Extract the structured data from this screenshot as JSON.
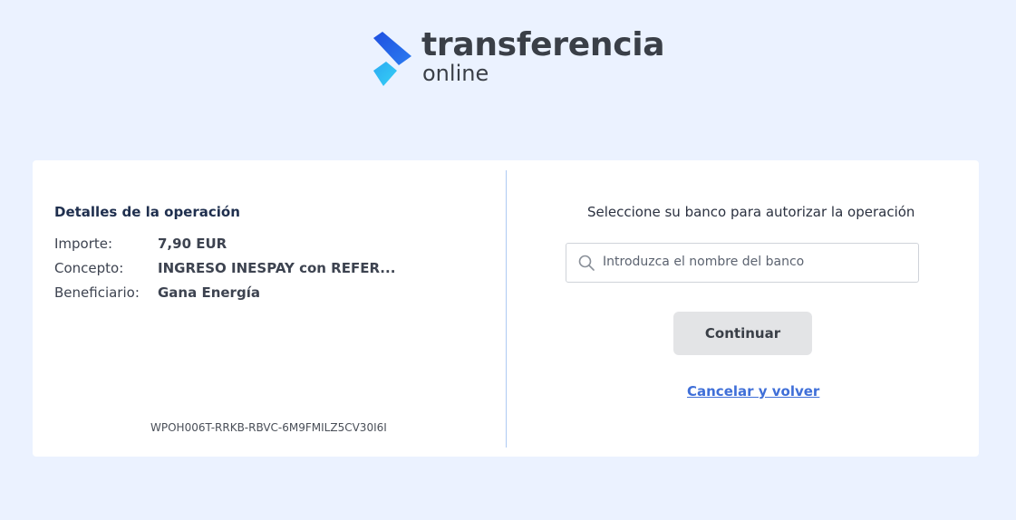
{
  "brand": {
    "name_line1": "transferencia",
    "name_line2": "online",
    "logo_icon": "diamond-arrow-logo",
    "colors": {
      "logo_dark": "#1f4fe0",
      "logo_light": "#2bbdf2"
    }
  },
  "details": {
    "title": "Detalles de la operación",
    "rows": [
      {
        "label": "Importe:",
        "value": "7,90 EUR"
      },
      {
        "label": "Concepto:",
        "value": "INGRESO INESPAY con REFER..."
      },
      {
        "label": "Beneficiario:",
        "value": "Gana Energía"
      }
    ],
    "reference": "WPOH006T-RRKB-RBVC-6M9FMILZ5CV30I6I"
  },
  "bank_selection": {
    "title": "Seleccione su banco para autorizar la operación",
    "search_icon": "search-icon",
    "search_placeholder": "Introduzca el nombre del banco",
    "search_value": "",
    "continue_label": "Continuar",
    "cancel_label": "Cancelar y volver",
    "colors": {
      "link": "#3f6fd8",
      "button_bg": "#e3e4e6"
    }
  }
}
